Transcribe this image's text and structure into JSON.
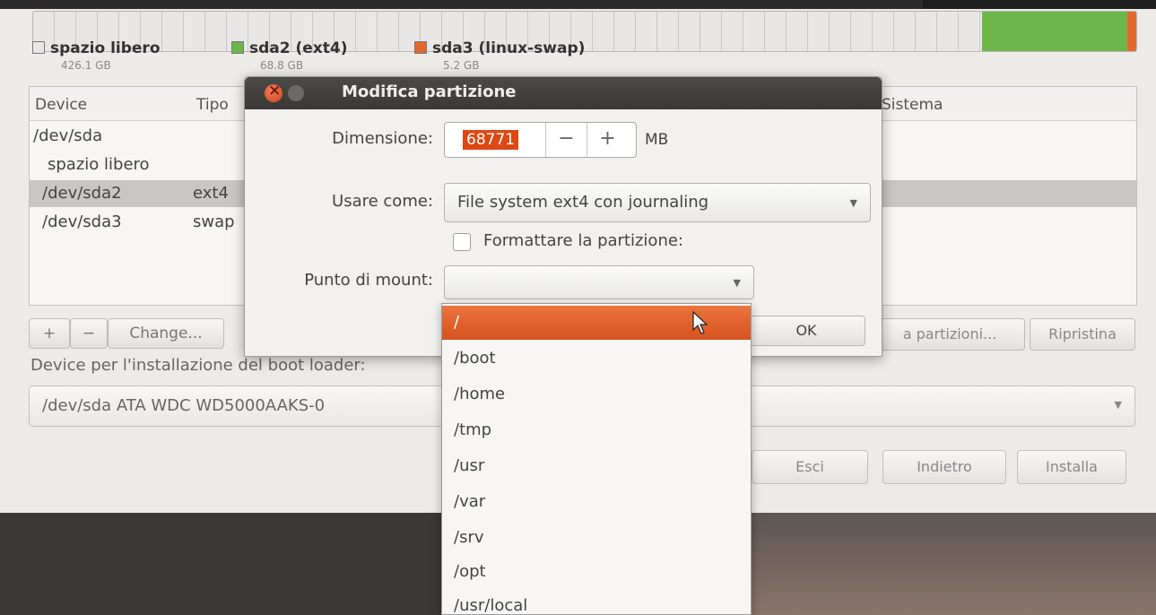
{
  "disk_usage": {
    "free_fraction": 0.86,
    "ext4_fraction": 0.132,
    "swap_fraction": 0.008
  },
  "legend": [
    {
      "name": "spazio libero",
      "size": "426.1 GB",
      "color": "#e8e7e5"
    },
    {
      "name": "sda2 (ext4)",
      "size": "68.8 GB",
      "color": "#6db64a"
    },
    {
      "name": "sda3 (linux-swap)",
      "size": "5.2 GB",
      "color": "#e2692d"
    }
  ],
  "table": {
    "headers": {
      "device": "Device",
      "type": "Tipo",
      "system": "Sistema"
    },
    "rows": [
      {
        "device": "/dev/sda",
        "type": ""
      },
      {
        "device": "spazio libero",
        "type": ""
      },
      {
        "device": "/dev/sda2",
        "type": "ext4"
      },
      {
        "device": "/dev/sda3",
        "type": "swap"
      }
    ]
  },
  "partition_buttons": {
    "add": "+",
    "remove": "−",
    "change": "Change..."
  },
  "right_buttons": {
    "new_table": "a partizioni...",
    "revert": "Ripristina"
  },
  "boot": {
    "label": "Device per l'installazione del boot loader:",
    "value": "/dev/sda   ATA WDC WD5000AAKS-0"
  },
  "nav_buttons": {
    "quit": "Esci",
    "back": "Indietro",
    "install": "Installa"
  },
  "dialog": {
    "title": "Modifica partizione",
    "size_label": "Dimensione:",
    "size_value": "68771",
    "size_minus": "−",
    "size_plus": "+",
    "size_unit": "MB",
    "use_as_label": "Usare come:",
    "use_as_value": "File system ext4 con journaling",
    "format_label": "Formattare la partizione:",
    "format_checked": false,
    "mount_label": "Punto di mount:",
    "mount_value": "",
    "ok_label": "OK"
  },
  "mount_options": [
    "/",
    "/boot",
    "/home",
    "/tmp",
    "/usr",
    "/var",
    "/srv",
    "/opt",
    "/usr/local"
  ],
  "mount_highlighted": "/",
  "colors": {
    "accent": "#dd4814",
    "ext4": "#6db64a",
    "swap": "#e2692d"
  }
}
